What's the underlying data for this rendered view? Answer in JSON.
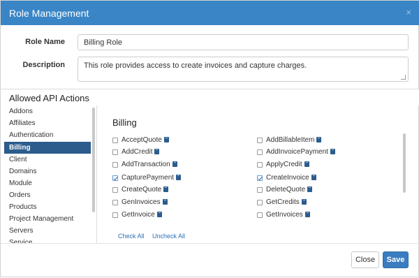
{
  "modal": {
    "title": "Role Management",
    "close_glyph": "×"
  },
  "form": {
    "role_name_label": "Role Name",
    "role_name_value": "Billing Role",
    "description_label": "Description",
    "description_value": "This role provides access to create invoices and capture charges."
  },
  "section_title": "Allowed API Actions",
  "sidebar": {
    "items": [
      {
        "label": "Addons",
        "active": false
      },
      {
        "label": "Affiliates",
        "active": false
      },
      {
        "label": "Authentication",
        "active": false
      },
      {
        "label": "Billing",
        "active": true
      },
      {
        "label": "Client",
        "active": false
      },
      {
        "label": "Domains",
        "active": false
      },
      {
        "label": "Module",
        "active": false
      },
      {
        "label": "Orders",
        "active": false
      },
      {
        "label": "Products",
        "active": false
      },
      {
        "label": "Project Management",
        "active": false
      },
      {
        "label": "Servers",
        "active": false
      },
      {
        "label": "Service",
        "active": false
      }
    ]
  },
  "panel": {
    "title": "Billing",
    "doc_icon": "book-icon",
    "left_actions": [
      {
        "label": "AcceptQuote",
        "checked": false
      },
      {
        "label": "AddCredit",
        "checked": false
      },
      {
        "label": "AddTransaction",
        "checked": false
      },
      {
        "label": "CapturePayment",
        "checked": true
      },
      {
        "label": "CreateQuote",
        "checked": false
      },
      {
        "label": "GenInvoices",
        "checked": false
      },
      {
        "label": "GetInvoice",
        "checked": false
      }
    ],
    "right_actions": [
      {
        "label": "AddBillableItem",
        "checked": false
      },
      {
        "label": "AddInvoicePayment",
        "checked": false
      },
      {
        "label": "ApplyCredit",
        "checked": false
      },
      {
        "label": "CreateInvoice",
        "checked": true
      },
      {
        "label": "DeleteQuote",
        "checked": false
      },
      {
        "label": "GetCredits",
        "checked": false
      },
      {
        "label": "GetInvoices",
        "checked": false
      }
    ],
    "check_all": "Check All",
    "uncheck_all": "Uncheck All"
  },
  "footer": {
    "close_label": "Close",
    "save_label": "Save"
  },
  "colors": {
    "header": "#3a85c6",
    "active_item": "#2b5c8c",
    "save_button": "#3a7cc0",
    "link": "#2b6fb6"
  }
}
